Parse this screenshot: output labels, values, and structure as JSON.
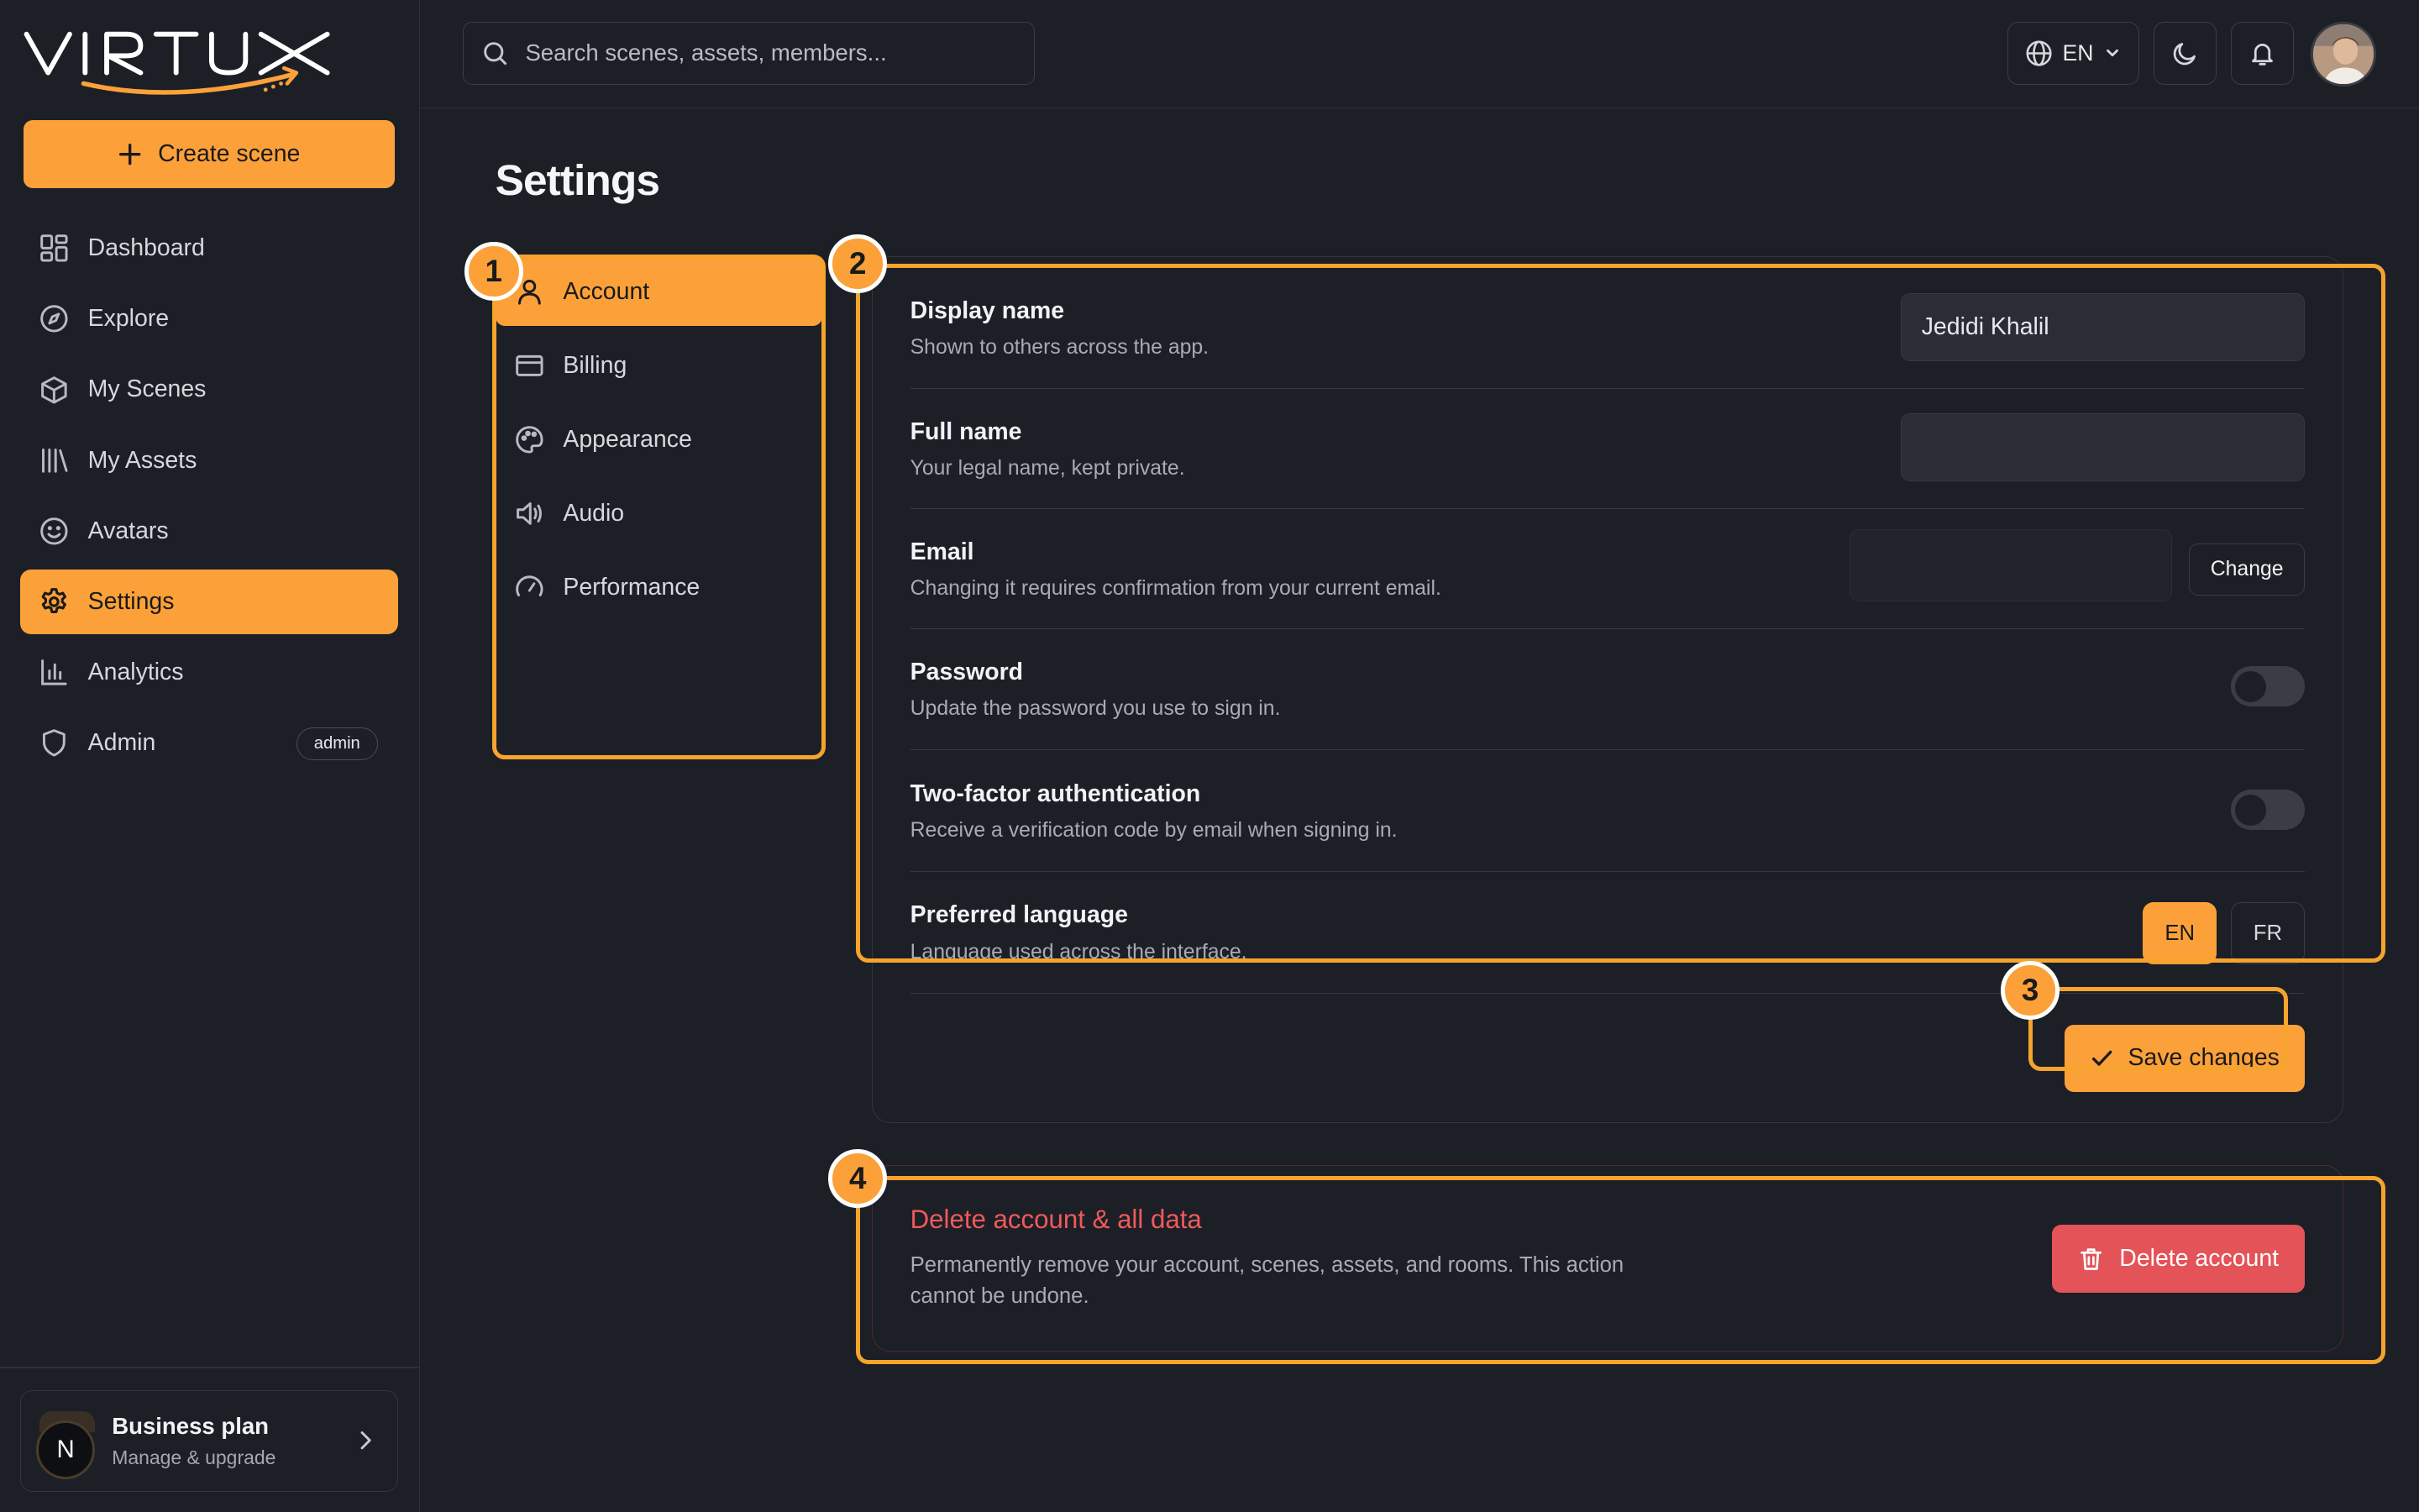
{
  "app": {
    "brand": "VIRTUX",
    "accent_color": "#fca139",
    "danger_color": "#e35357"
  },
  "sidebar": {
    "create_label": "Create scene",
    "items": [
      {
        "label": "Dashboard",
        "icon": "dashboard-icon"
      },
      {
        "label": "Explore",
        "icon": "compass-icon"
      },
      {
        "label": "My Scenes",
        "icon": "cube-icon"
      },
      {
        "label": "My Assets",
        "icon": "library-icon"
      },
      {
        "label": "Avatars",
        "icon": "smile-icon"
      },
      {
        "label": "Settings",
        "icon": "gear-icon",
        "active": true
      },
      {
        "label": "Analytics",
        "icon": "bar-chart-icon"
      },
      {
        "label": "Admin",
        "icon": "shield-icon",
        "badge": "admin"
      }
    ],
    "plan": {
      "avatar_letter": "N",
      "title": "Business plan",
      "subtitle": "Manage & upgrade"
    }
  },
  "topbar": {
    "search_placeholder": "Search scenes, assets, members...",
    "language": "EN"
  },
  "page": {
    "title": "Settings",
    "subnav": [
      {
        "label": "Account",
        "icon": "user-icon",
        "active": true
      },
      {
        "label": "Billing",
        "icon": "credit-card-icon"
      },
      {
        "label": "Appearance",
        "icon": "palette-icon"
      },
      {
        "label": "Audio",
        "icon": "speaker-icon"
      },
      {
        "label": "Performance",
        "icon": "gauge-icon"
      }
    ],
    "account": {
      "display_name": {
        "label": "Display name",
        "desc": "Shown to others across the app.",
        "value": "Jedidi Khalil"
      },
      "full_name": {
        "label": "Full name",
        "desc": "Your legal name, kept private.",
        "value": ""
      },
      "email": {
        "label": "Email",
        "desc": "Changing it requires confirmation from your current email.",
        "value": "",
        "change_label": "Change"
      },
      "password": {
        "label": "Password",
        "desc": "Update the password you use to sign in.",
        "enabled": false
      },
      "two_factor": {
        "label": "Two-factor authentication",
        "desc": "Receive a verification code by email when signing in.",
        "enabled": false
      },
      "language": {
        "label": "Preferred language",
        "desc": "Language used across the interface.",
        "options": [
          "EN",
          "FR"
        ],
        "selected": "EN"
      },
      "save_label": "Save changes"
    },
    "danger": {
      "title": "Delete account & all data",
      "desc": "Permanently remove your account, scenes, assets, and rooms. This action cannot be undone.",
      "button_label": "Delete account"
    }
  },
  "annotations": [
    "1",
    "2",
    "3",
    "4"
  ]
}
